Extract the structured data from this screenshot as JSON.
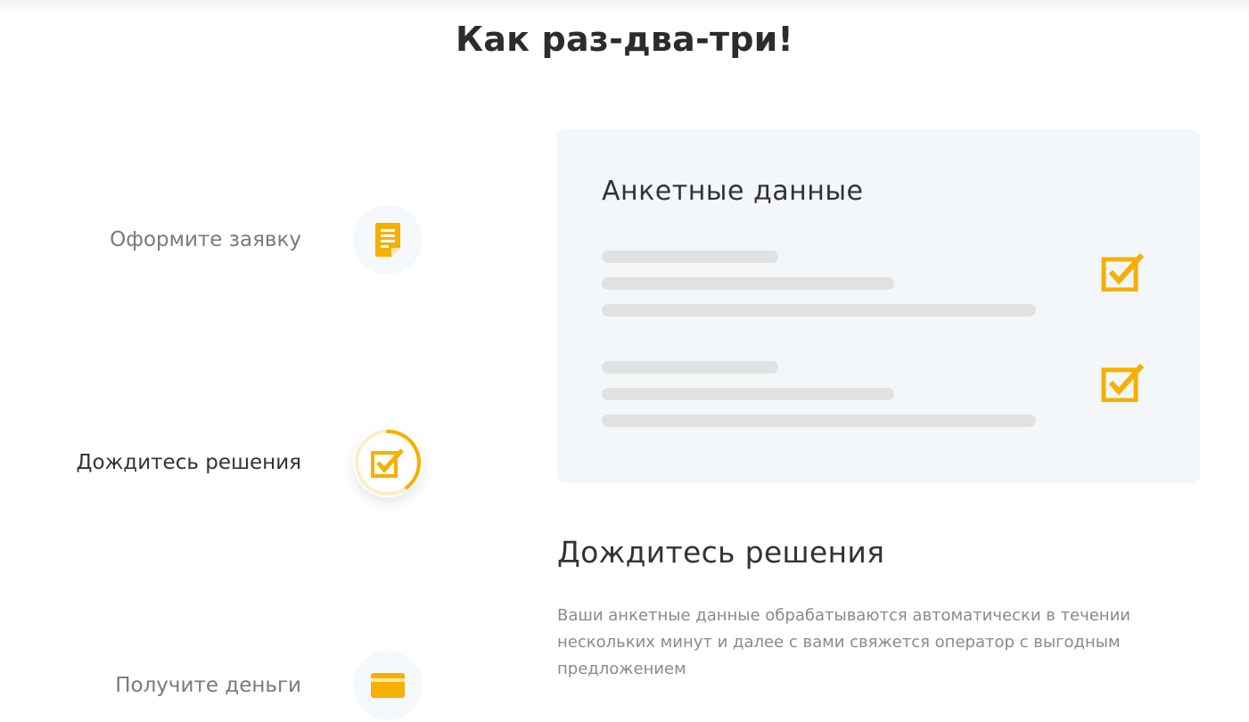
{
  "section": {
    "title": "Как раз-два-три!"
  },
  "steps": [
    {
      "label": "Оформите заявку",
      "icon": "document-icon"
    },
    {
      "label": "Дождитесь решения",
      "icon": "checkbox-icon"
    },
    {
      "label": "Получите деньги",
      "icon": "card-icon"
    }
  ],
  "card": {
    "title": "Анкетные данные"
  },
  "description": {
    "title": "Дождитесь решения",
    "text": "Ваши анкетные данные обрабатываются автоматически в течении нескольких минут и далее с вами свяжется оператор с выгодным предложением"
  },
  "colors": {
    "accent": "#f5b000",
    "card_bg": "#f3f7fa",
    "placeholder_bar": "#e1e1e1"
  }
}
